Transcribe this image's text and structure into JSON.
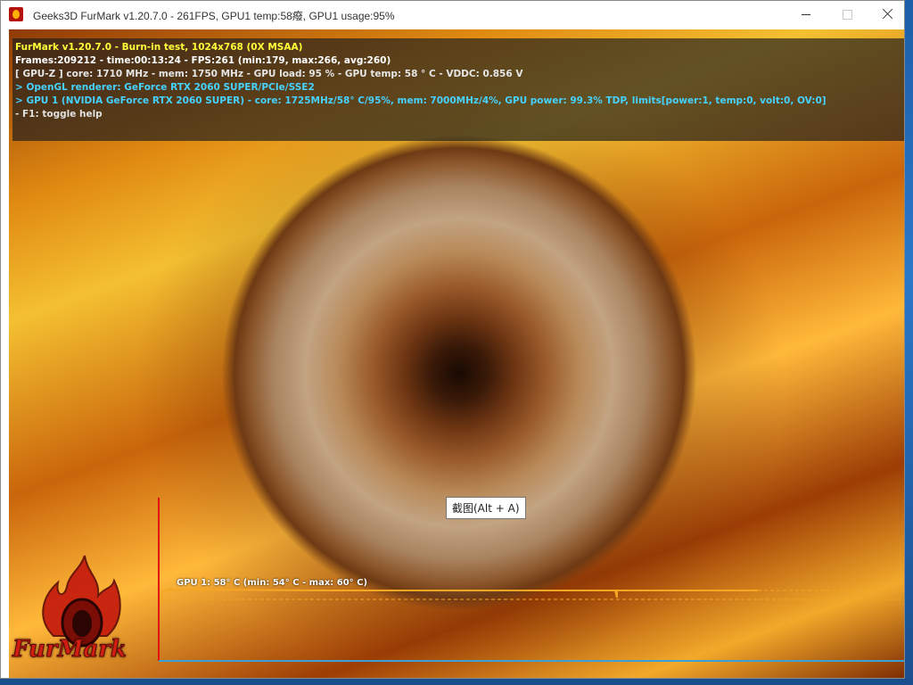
{
  "window": {
    "title": "Geeks3D FurMark v1.20.7.0 - 261FPS, GPU1 temp:58癈, GPU1 usage:95%",
    "icon": "furmark-app-icon"
  },
  "hud": {
    "line1": "FurMark v1.20.7.0 - Burn-in test, 1024x768 (0X MSAA)",
    "line2": "Frames:209212 - time:00:13:24 - FPS:261 (min:179, max:266, avg:260)",
    "line3": "[ GPU-Z ] core: 1710 MHz - mem: 1750 MHz - GPU load: 95 % - GPU temp: 58 ° C - VDDC: 0.856 V",
    "line4": "> OpenGL renderer: GeForce RTX 2060 SUPER/PCIe/SSE2",
    "line5": "> GPU 1 (NVIDIA GeForce RTX 2060 SUPER) - core: 1725MHz/58° C/95%, mem: 7000MHz/4%, GPU power: 99.3% TDP, limits[power:1, temp:0, volt:0, OV:0]",
    "line6": "- F1: toggle help"
  },
  "tooltip": {
    "text": "截图(Alt + A)"
  },
  "temp_graph": {
    "label": "GPU 1: 58° C (min: 54° C - max: 60° C)",
    "current_temp": 58,
    "min_temp": 54,
    "max_temp": 60
  },
  "logo": {
    "text": "FurMark"
  },
  "colors": {
    "hud_title": "#ffff3a",
    "hud_info": "#46d2ff",
    "graph_line": "#f5a623",
    "graph_axis": "#3aa0d8",
    "graph_y_axis": "#e01010"
  }
}
